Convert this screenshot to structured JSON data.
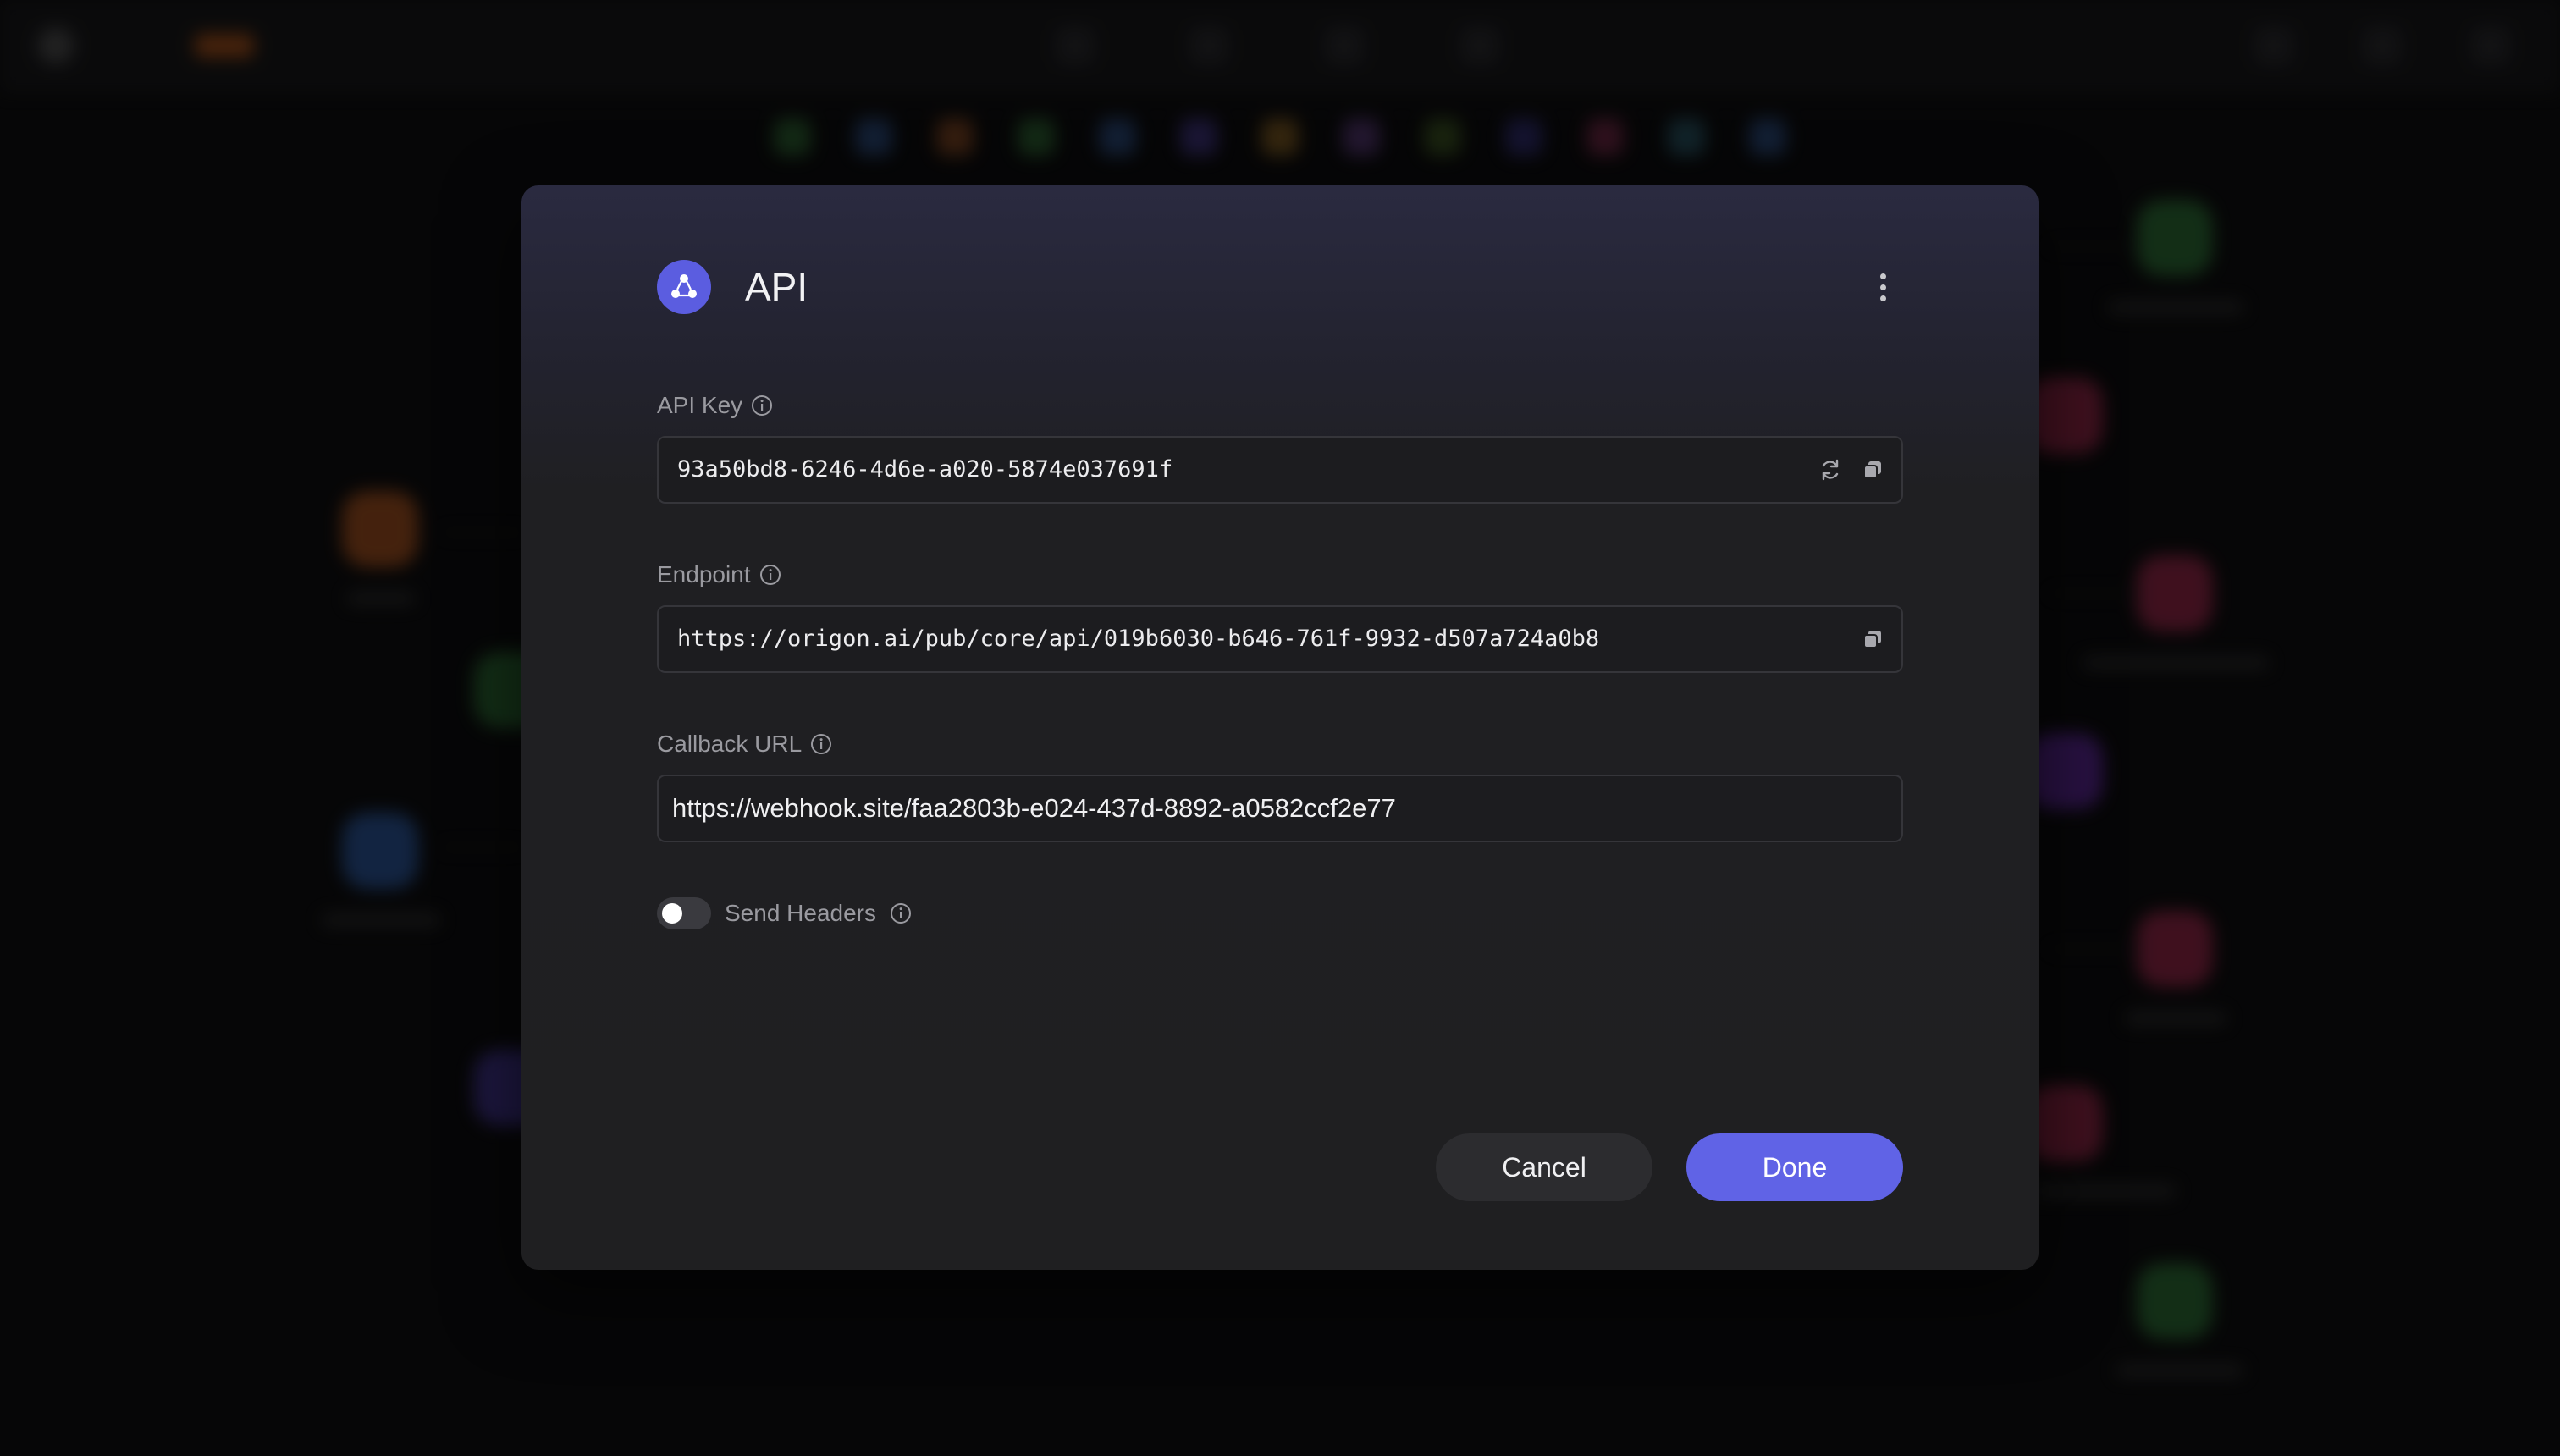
{
  "modal": {
    "title": "API",
    "icon": "api-icon",
    "menu_icon": "more-vertical-icon",
    "api_key": {
      "label": "API Key",
      "value": "93a50bd8-6246-4d6e-a020-5874e037691f",
      "actions": [
        "refresh-icon",
        "copy-icon"
      ]
    },
    "endpoint": {
      "label": "Endpoint",
      "value": "https://origon.ai/pub/core/api/019b6030-b646-761f-9932-d507a724a0b8",
      "actions": [
        "copy-icon"
      ]
    },
    "callback_url": {
      "label": "Callback URL",
      "value": "https://webhook.site/faa2803b-e024-437d-8892-a0582ccf2e77"
    },
    "send_headers": {
      "label": "Send Headers",
      "enabled": false
    },
    "buttons": {
      "cancel": "Cancel",
      "done": "Done"
    }
  },
  "colors": {
    "accent": "#6063e6",
    "modal_bg": "#1f1f21",
    "field_border": "#35353a",
    "label_text": "#9a9aa0"
  }
}
